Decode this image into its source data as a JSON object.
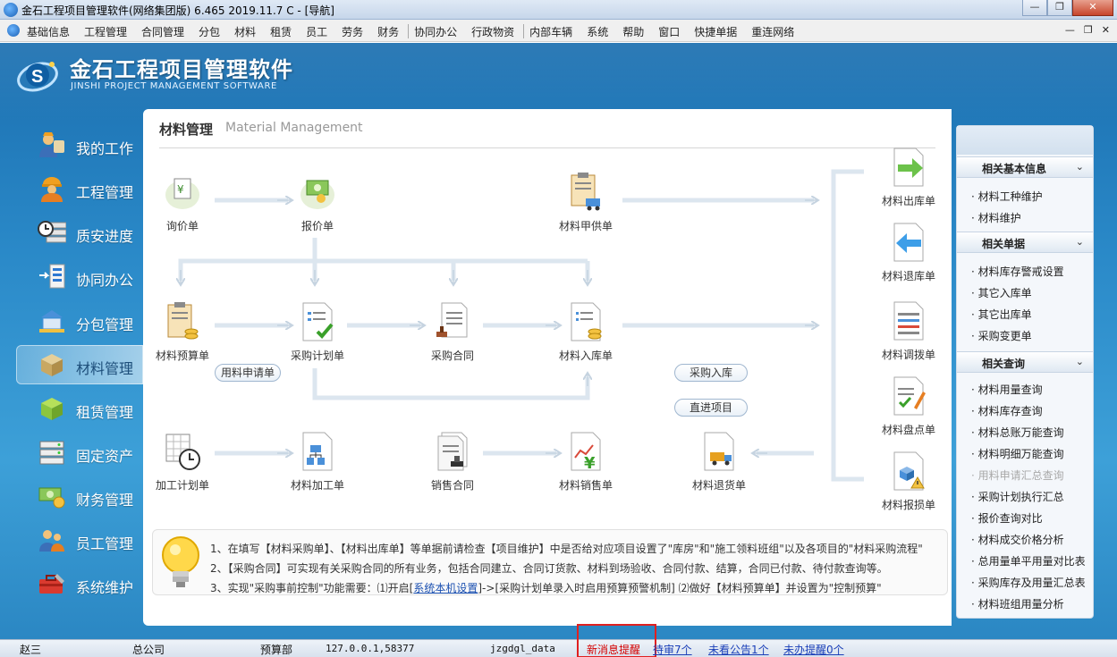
{
  "window": {
    "title": "金石工程项目管理软件(网络集团版) 6.465  2019.11.7 C - [导航]",
    "minimize": "—",
    "restore": "❐",
    "close": "✕"
  },
  "menubar": {
    "items": [
      "基础信息",
      "工程管理",
      "合同管理",
      "分包",
      "材料",
      "租赁",
      "员工",
      "劳务",
      "财务",
      "协同办公",
      "行政物资",
      "内部车辆",
      "系统",
      "帮助",
      "窗口",
      "快捷单据",
      "重连网络"
    ],
    "mdi_minimize": "—",
    "mdi_restore": "❐",
    "mdi_close": "✕"
  },
  "brand": {
    "name_cn": "金石工程项目管理软件",
    "name_en": "JINSHI PROJECT MANAGEMENT SOFTWARE"
  },
  "nav": [
    {
      "label": "我的工作",
      "icon": "worker-icon"
    },
    {
      "label": "工程管理",
      "icon": "engineer-icon"
    },
    {
      "label": "质安进度",
      "icon": "clock-schedule-icon"
    },
    {
      "label": "协同办公",
      "icon": "collaboration-icon"
    },
    {
      "label": "分包管理",
      "icon": "subcontract-icon"
    },
    {
      "label": "材料管理",
      "icon": "material-box-icon",
      "active": true
    },
    {
      "label": "租赁管理",
      "icon": "lease-cube-icon"
    },
    {
      "label": "固定资产",
      "icon": "server-icon"
    },
    {
      "label": "财务管理",
      "icon": "money-icon"
    },
    {
      "label": "员工管理",
      "icon": "staff-icon"
    },
    {
      "label": "系统维护",
      "icon": "toolbox-icon"
    }
  ],
  "panel": {
    "title": "材料管理",
    "subtitle": "Material Management"
  },
  "flow": {
    "inquiry": "询价单",
    "quote": "报价单",
    "supply": "材料甲供单",
    "outbound": "材料出库单",
    "budget": "材料预算单",
    "plan": "采购计划单",
    "contract": "采购合同",
    "inbound": "材料入库单",
    "return": "材料退库单",
    "transfer": "材料调拨单",
    "inventory": "材料盘点单",
    "processing_plan": "加工计划单",
    "processing": "材料加工单",
    "sales_contract": "销售合同",
    "sales": "材料销售单",
    "return_goods": "材料退货单",
    "damage": "材料报损单",
    "pill_request": "用料申请单",
    "pill_purchase_in": "采购入库",
    "pill_direct": "直进项目"
  },
  "tips": {
    "line1": "1、在填写【材料采购单】、【材料出库单】等单据前请检查【项目维护】中是否给对应项目设置了\"库房\"和\"施工领料班组\"以及各项目的\"材料采购流程\"",
    "line2": "2、【采购合同】可实现有关采购合同的所有业务，包括合同建立、合同订货款、材料到场验收、合同付款、结算，合同已付款、待付款查询等。",
    "line3_a": "3、实现\"采购事前控制\"功能需要：⑴开启[",
    "line3_link": "系统本机设置",
    "line3_b": "]->[采购计划单录入时启用预算预警机制]  ⑵做好【材料预算单】并设置为\"控制预算\""
  },
  "right_panel": {
    "sections": [
      {
        "title": "相关基本信息",
        "items": [
          "材料工种维护",
          "材料维护"
        ]
      },
      {
        "title": "相关单据",
        "items": [
          "材料库存警戒设置",
          "其它入库单",
          "其它出库单",
          "采购变更单"
        ]
      },
      {
        "title": "相关查询",
        "items": [
          "材料用量查询",
          "材料库存查询",
          "材料总账万能查询",
          "材料明细万能查询",
          "用料申请汇总查询",
          "采购计划执行汇总",
          "报价查询对比",
          "材料成交价格分析",
          "总用量单平用量对比表",
          "采购库存及用量汇总表",
          "材料班组用量分析"
        ]
      }
    ],
    "chevron": "⌄"
  },
  "status": {
    "user": "赵三",
    "company": "总公司",
    "dept": "预算部",
    "server": "127.0.0.1,58377",
    "db": "jzgdgl_data",
    "new_msg": "新消息提醒",
    "pending_review": "待审7个",
    "unread_notice": "未看公告1个",
    "todo": "未办提醒0个"
  },
  "colors": {
    "accent_blue": "#2a89c8",
    "alert_red": "#d40000",
    "link_blue": "#1a3fb8"
  }
}
